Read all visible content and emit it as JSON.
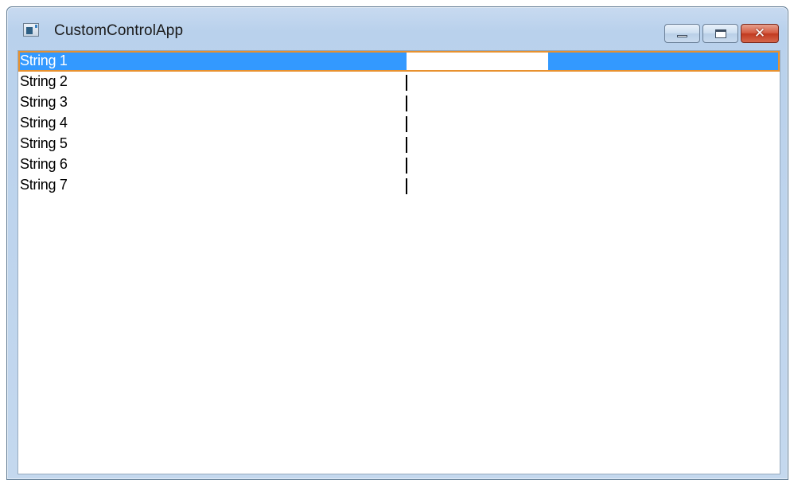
{
  "window": {
    "title": "CustomControlApp",
    "icon": "app-window-icon",
    "caption_buttons": {
      "minimize_icon": "minimize-icon",
      "maximize_icon": "maximize-icon",
      "close_icon": "close-icon",
      "close_glyph": "✕"
    }
  },
  "list": {
    "selected_index": 0,
    "items": [
      {
        "label": "String 1"
      },
      {
        "label": "String 2"
      },
      {
        "label": "String 3"
      },
      {
        "label": "String 4"
      },
      {
        "label": "String 5"
      },
      {
        "label": "String 6"
      },
      {
        "label": "String 7"
      }
    ]
  },
  "colors": {
    "selection": "#3399ff",
    "focus_border": "#e8912e",
    "close_button": "#c13a1f",
    "titlebar": "#b9d1ec"
  }
}
